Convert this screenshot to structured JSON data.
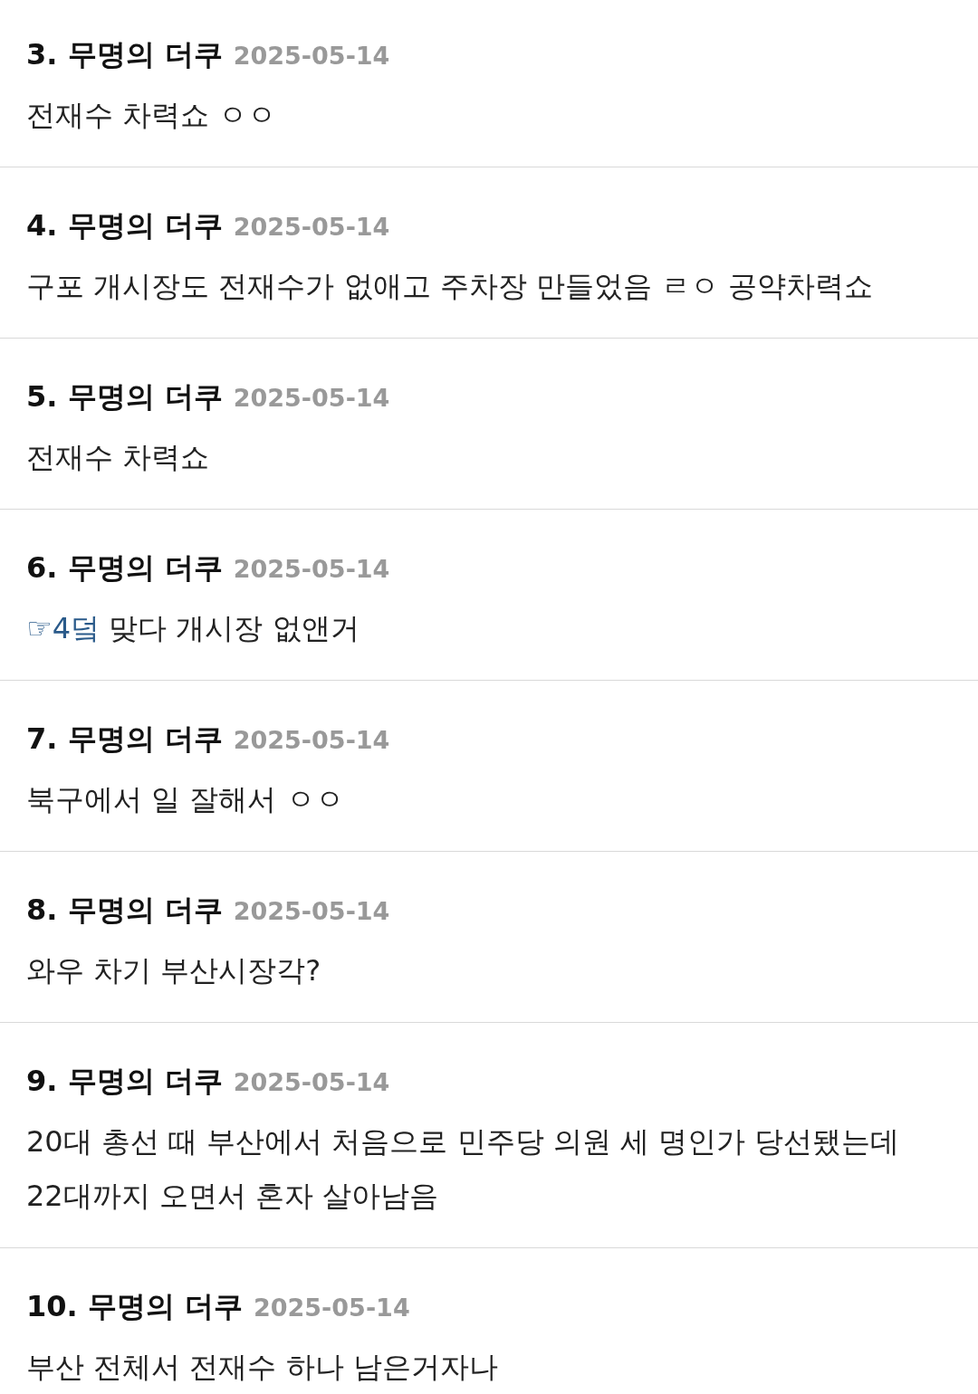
{
  "comments": [
    {
      "number": "3.",
      "author": "무명의 더쿠",
      "date": "2025-05-14",
      "body": "전재수 차력쇼 ㅇㅇ"
    },
    {
      "number": "4.",
      "author": "무명의 더쿠",
      "date": "2025-05-14",
      "body": "구포 개시장도 전재수가 없애고 주차장 만들었음 ㄹㅇ 공약차력쇼"
    },
    {
      "number": "5.",
      "author": "무명의 더쿠",
      "date": "2025-05-14",
      "body": "전재수 차력쇼"
    },
    {
      "number": "6.",
      "author": "무명의 더쿠",
      "date": "2025-05-14",
      "reply_link": "☞4덬",
      "body": "맞다 개시장 없앤거"
    },
    {
      "number": "7.",
      "author": "무명의 더쿠",
      "date": "2025-05-14",
      "body": "북구에서 일 잘해서 ㅇㅇ"
    },
    {
      "number": "8.",
      "author": "무명의 더쿠",
      "date": "2025-05-14",
      "body": "와우 차기 부산시장각?"
    },
    {
      "number": "9.",
      "author": "무명의 더쿠",
      "date": "2025-05-14",
      "body": "20대 총선 때 부산에서 처음으로 민주당 의원 세 명인가 당선됐는데 22대까지 오면서 혼자 살아남음"
    },
    {
      "number": "10.",
      "author": "무명의 더쿠",
      "date": "2025-05-14",
      "body": "부산 전체서 전재수 하나 남은거자나"
    }
  ]
}
